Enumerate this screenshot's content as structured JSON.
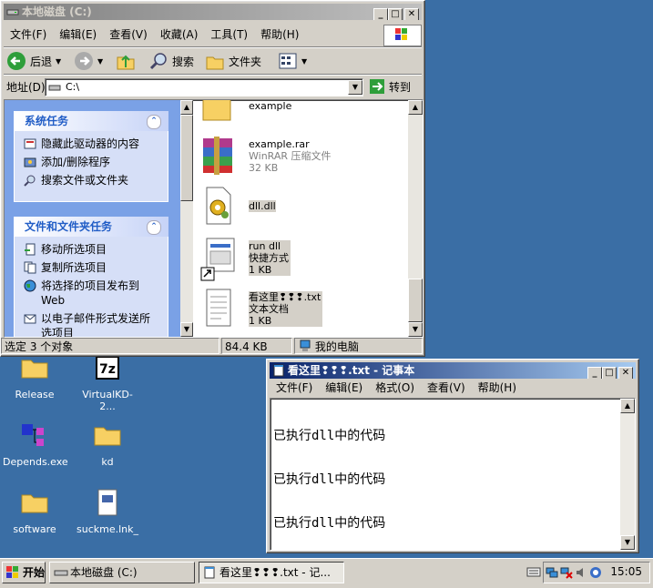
{
  "explorer": {
    "title": "本地磁盘 (C:)",
    "menu": [
      "文件(F)",
      "编辑(E)",
      "查看(V)",
      "收藏(A)",
      "工具(T)",
      "帮助(H)"
    ],
    "toolbar": {
      "back": "后退",
      "search": "搜索",
      "folders": "文件夹"
    },
    "address_label": "地址(D)",
    "address_value": "C:\\",
    "go_label": "转到",
    "system_tasks": {
      "title": "系统任务",
      "items": [
        "隐藏此驱动器的内容",
        "添加/删除程序",
        "搜索文件或文件夹"
      ]
    },
    "file_tasks": {
      "title": "文件和文件夹任务",
      "items": [
        "移动所选项目",
        "复制所选项目",
        "将选择的项目发布到 Web",
        "以电子邮件形式发送所选项目"
      ]
    },
    "files": [
      {
        "name": "example",
        "type": "",
        "size": ""
      },
      {
        "name": "example.rar",
        "type": "WinRAR 压缩文件",
        "size": "32 KB"
      },
      {
        "name": "dll.dll",
        "type": "",
        "size": ""
      },
      {
        "name": "run dll",
        "type": "快捷方式",
        "size": "1 KB"
      },
      {
        "name": "看这里❢❢❢.txt",
        "type": "文本文档",
        "size": "1 KB"
      }
    ],
    "status": {
      "selection": "选定 3 个对象",
      "size": "84.4 KB",
      "location": "我的电脑"
    }
  },
  "notepad": {
    "title": "看这里❢❢❢.txt - 记事本",
    "menu": [
      "文件(F)",
      "编辑(E)",
      "格式(O)",
      "查看(V)",
      "帮助(H)"
    ],
    "lines": [
      "已执行dll中的代码",
      "已执行dll中的代码",
      "已执行dll中的代码"
    ]
  },
  "desktop_icons": [
    {
      "label": "Release"
    },
    {
      "label": "VirtualKD-2..."
    },
    {
      "label": "Depends.exe"
    },
    {
      "label": "kd"
    },
    {
      "label": "software"
    },
    {
      "label": "suckme.lnk_"
    }
  ],
  "taskbar": {
    "start": "开始",
    "tasks": [
      "本地磁盘 (C:)",
      "看这里❢❢❢.txt - 记..."
    ],
    "clock": "15:05"
  },
  "colors": {
    "desktop": "#3a6ea5",
    "title_active": "#0a246a",
    "taskpane_head": "#215dc6"
  }
}
